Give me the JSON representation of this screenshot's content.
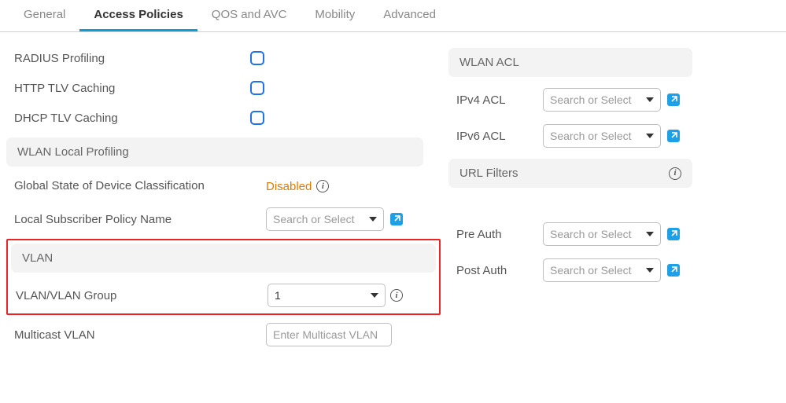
{
  "tabs": {
    "general": "General",
    "access_policies": "Access Policies",
    "qos_avc": "QOS and AVC",
    "mobility": "Mobility",
    "advanced": "Advanced",
    "active": "access_policies"
  },
  "left": {
    "radius_profiling": {
      "label": "RADIUS Profiling",
      "checked": false
    },
    "http_tlv_caching": {
      "label": "HTTP TLV Caching",
      "checked": false
    },
    "dhcp_tlv_caching": {
      "label": "DHCP TLV Caching",
      "checked": false
    },
    "wlan_local_profiling_header": "WLAN Local Profiling",
    "global_state": {
      "label": "Global State of Device Classification",
      "value": "Disabled"
    },
    "local_sub_policy": {
      "label": "Local Subscriber Policy Name",
      "placeholder": "Search or Select"
    },
    "vlan_header": "VLAN",
    "vlan_group": {
      "label": "VLAN/VLAN Group",
      "value": "1"
    },
    "multicast_vlan": {
      "label": "Multicast VLAN",
      "placeholder": "Enter Multicast VLAN"
    }
  },
  "right": {
    "wlan_acl_header": "WLAN ACL",
    "ipv4_acl": {
      "label": "IPv4 ACL",
      "placeholder": "Search or Select"
    },
    "ipv6_acl": {
      "label": "IPv6 ACL",
      "placeholder": "Search or Select"
    },
    "url_filters_header": "URL Filters",
    "pre_auth": {
      "label": "Pre Auth",
      "placeholder": "Search or Select"
    },
    "post_auth": {
      "label": "Post Auth",
      "placeholder": "Search or Select"
    }
  }
}
